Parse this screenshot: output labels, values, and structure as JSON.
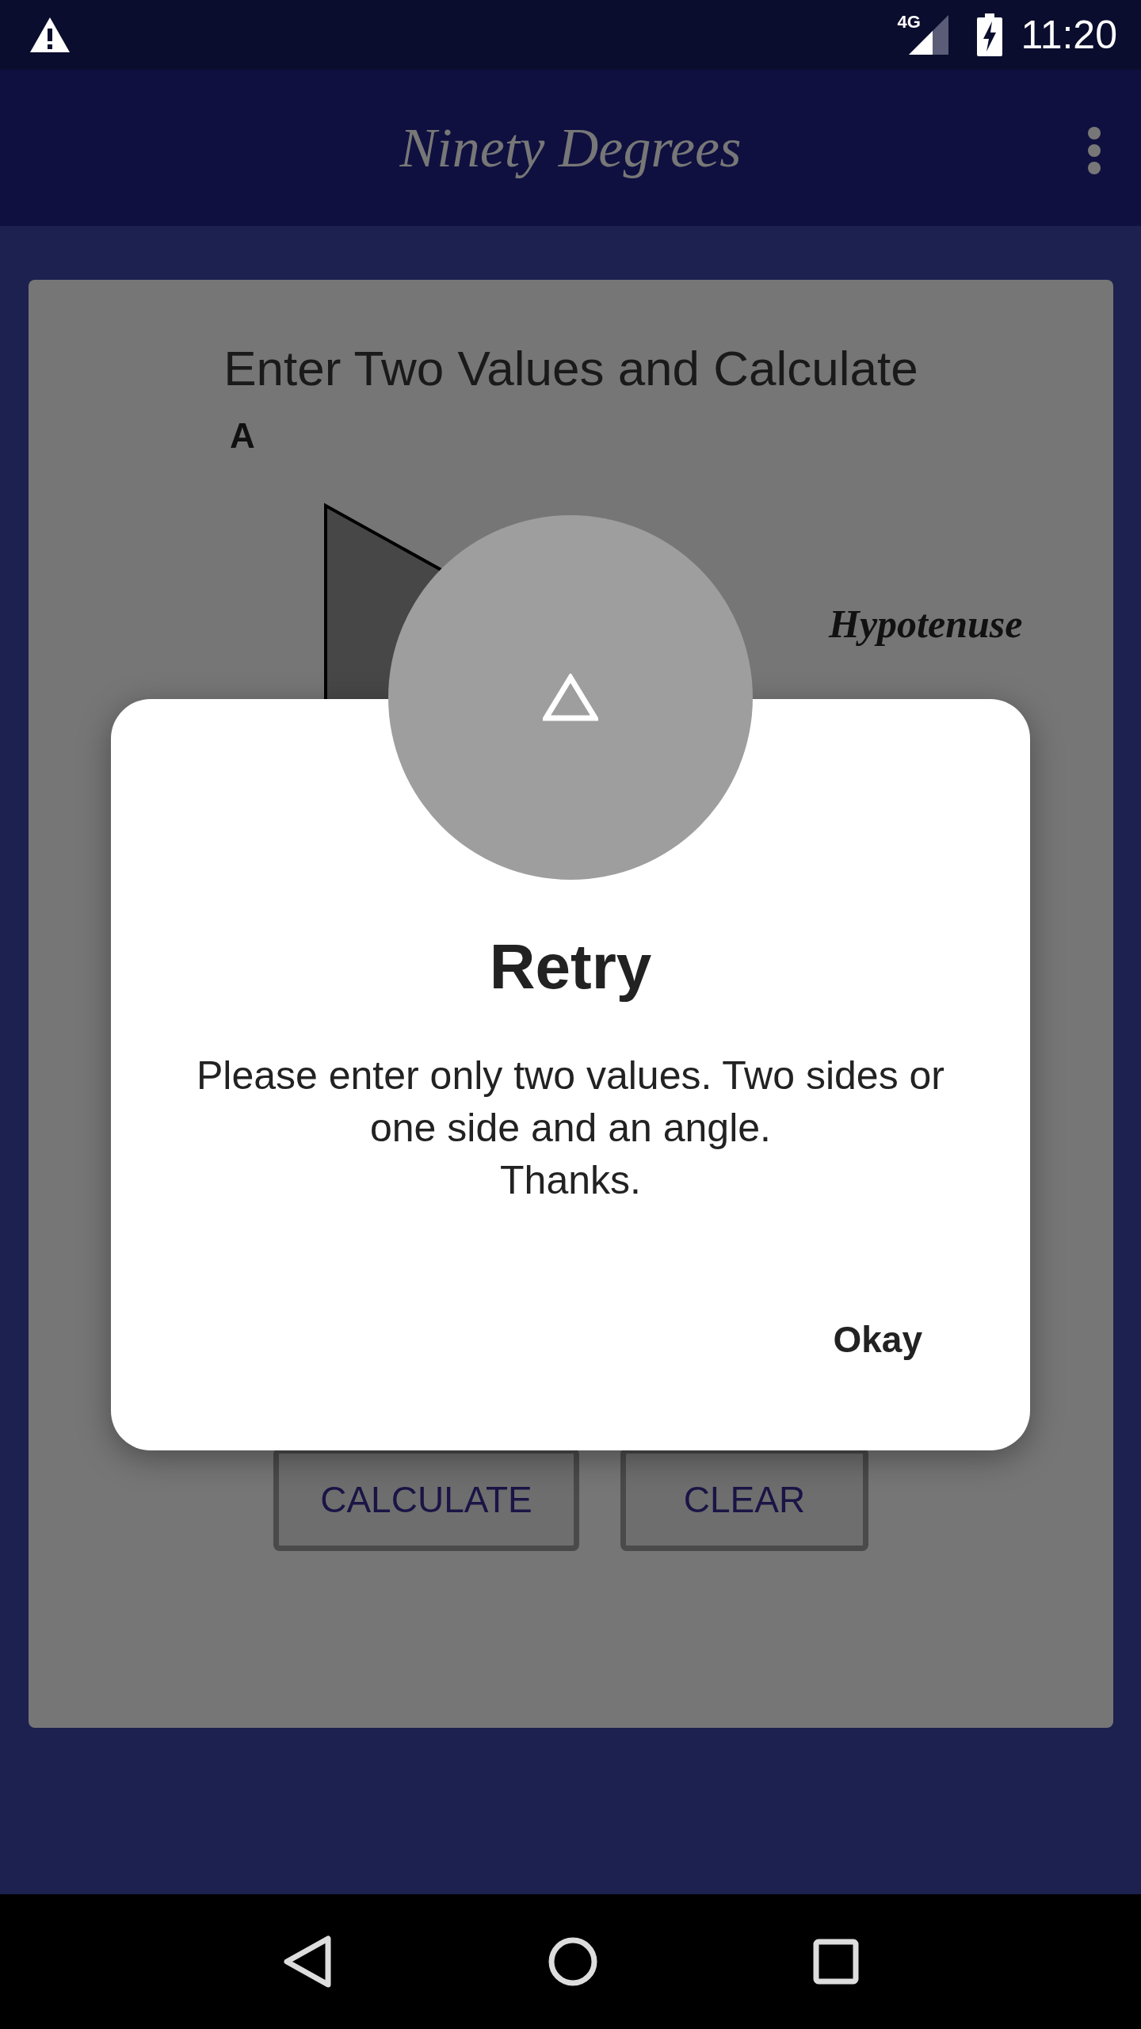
{
  "status_bar": {
    "network": "4G",
    "time": "11:20"
  },
  "app_bar": {
    "title": "Ninety Degrees"
  },
  "card": {
    "heading": "Enter Two Values and Calculate",
    "diagram_labels": [
      "A",
      "Hypotenuse"
    ],
    "buttons": [
      "CALCULATE",
      "CLEAR"
    ]
  },
  "dialog": {
    "title": "Retry",
    "message": "Please enter only two values. Two sides or one side and an angle.\nThanks.",
    "button": "Okay"
  }
}
